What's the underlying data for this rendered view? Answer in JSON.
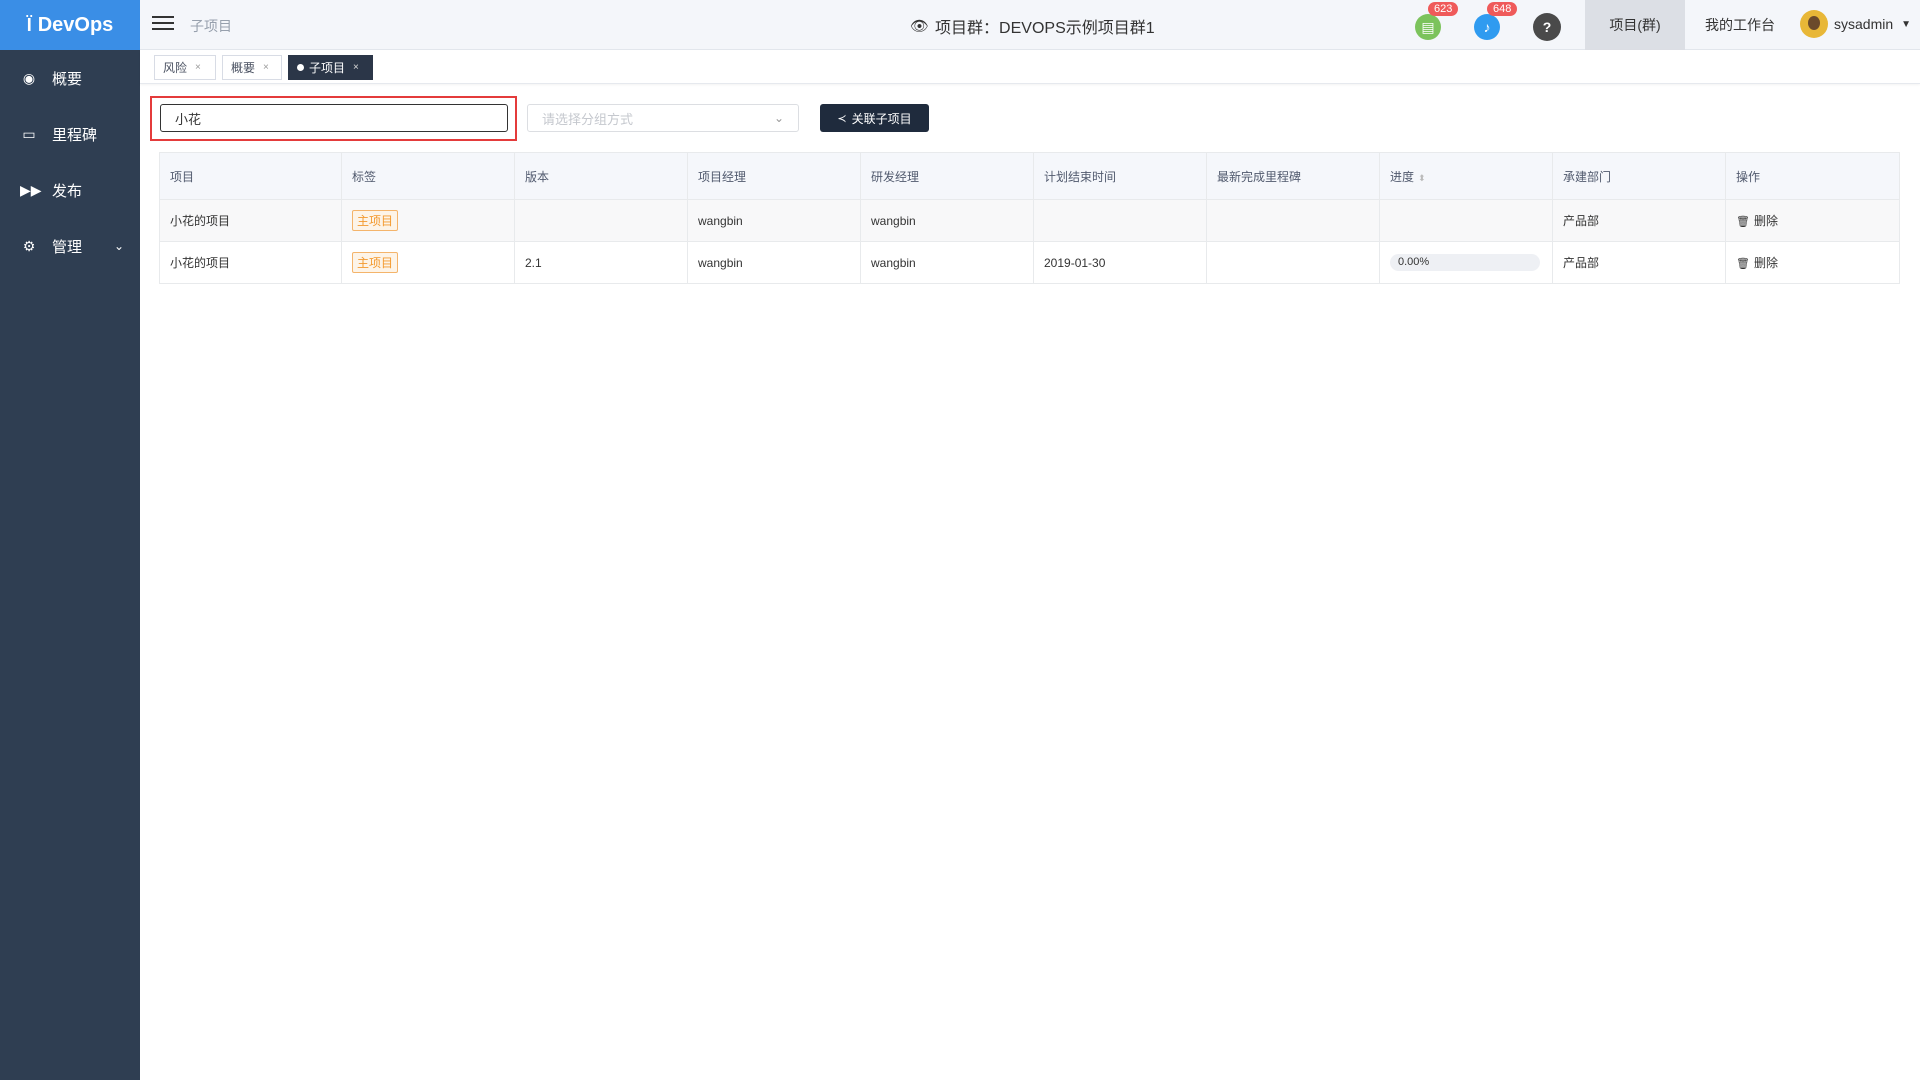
{
  "app": {
    "logo": "DevOps",
    "logo_icon": "devops-logo-icon"
  },
  "sidebar": {
    "items": [
      {
        "label": "概要",
        "icon": "dashboard-icon",
        "glyph": "◉"
      },
      {
        "label": "里程碑",
        "icon": "folder-icon",
        "glyph": "▭"
      },
      {
        "label": "发布",
        "icon": "fast-forward-icon",
        "glyph": "▶▶"
      },
      {
        "label": "管理",
        "icon": "gear-icon",
        "glyph": "⚙",
        "expandable": true
      }
    ]
  },
  "header": {
    "breadcrumb": "子项目",
    "group_title": "项目群：DEVOPS示例项目群1",
    "doc_badge": "623",
    "bell_badge": "648",
    "help": "?",
    "tab_projects": "项目(群)",
    "tab_workbench": "我的工作台",
    "username": "sysadmin"
  },
  "page_tabs": [
    {
      "label": "风险",
      "close": "×"
    },
    {
      "label": "概要",
      "close": "×"
    },
    {
      "label": "子项目",
      "close": "×",
      "active": true
    }
  ],
  "toolbar": {
    "search_value": "小花",
    "group_select_placeholder": "请选择分组方式",
    "link_button": "关联子项目"
  },
  "table": {
    "headers": [
      "项目",
      "标签",
      "版本",
      "项目经理",
      "研发经理",
      "计划结束时间",
      "最新完成里程碑",
      "进度",
      "承建部门",
      "操作"
    ],
    "rows": [
      {
        "project": "小花的项目",
        "tag": "主项目",
        "version": "",
        "pm": "wangbin",
        "dev_manager": "wangbin",
        "plan_end": "",
        "milestone": "",
        "progress": "",
        "dept": "产品部",
        "action": "删除"
      },
      {
        "project": "小花的项目",
        "tag": "主项目",
        "version": "2.1",
        "pm": "wangbin",
        "dev_manager": "wangbin",
        "plan_end": "2019-01-30",
        "milestone": "",
        "progress": "0.00%",
        "progress_value": 0,
        "dept": "产品部",
        "action": "删除"
      }
    ]
  },
  "colors": {
    "sidebar_bg": "#2f3e52",
    "logo_bg": "#3a8ee6",
    "active_tab": "#2b3648",
    "highlight": "#e43b3b",
    "tag_orange": "#f39a2f"
  }
}
